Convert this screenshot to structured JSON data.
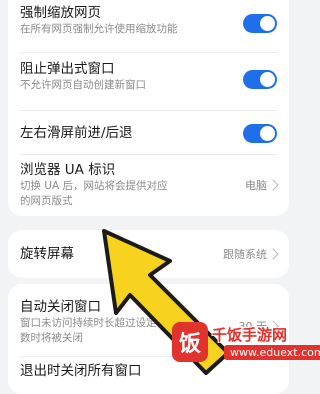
{
  "settings": {
    "force_zoom": {
      "title": "强制缩放网页",
      "subtitle": "在所有网页强制允许使用缩放功能",
      "enabled": true
    },
    "block_popups": {
      "title": "阻止弹出式窗口",
      "subtitle": "不允许网页自动创建新窗口",
      "enabled": true
    },
    "swipe_nav": {
      "title": "左右滑屏前进/后退",
      "enabled": true
    },
    "ua": {
      "title": "浏览器 UA 标识",
      "subtitle_line1": "切换 UA 后，网站将会提供对应",
      "subtitle_line2": "的网页版式",
      "value": "电脑"
    },
    "rotate": {
      "title": "旋转屏幕",
      "value": "跟随系统"
    },
    "auto_close": {
      "title": "自动关闭窗口",
      "subtitle_line1": "窗口未访问持续时长超过设定",
      "subtitle_line2": "数时将被关闭",
      "value": "30 天"
    },
    "exit_close": {
      "title": "退出时关闭所有窗口"
    }
  },
  "colors": {
    "accent": "#1f6feb",
    "arrow": "#f7d21e",
    "watermark": "#e1322d"
  },
  "watermark": {
    "logo_char": "饭",
    "name": "千饭手游网",
    "url": "www.eduext.com"
  }
}
